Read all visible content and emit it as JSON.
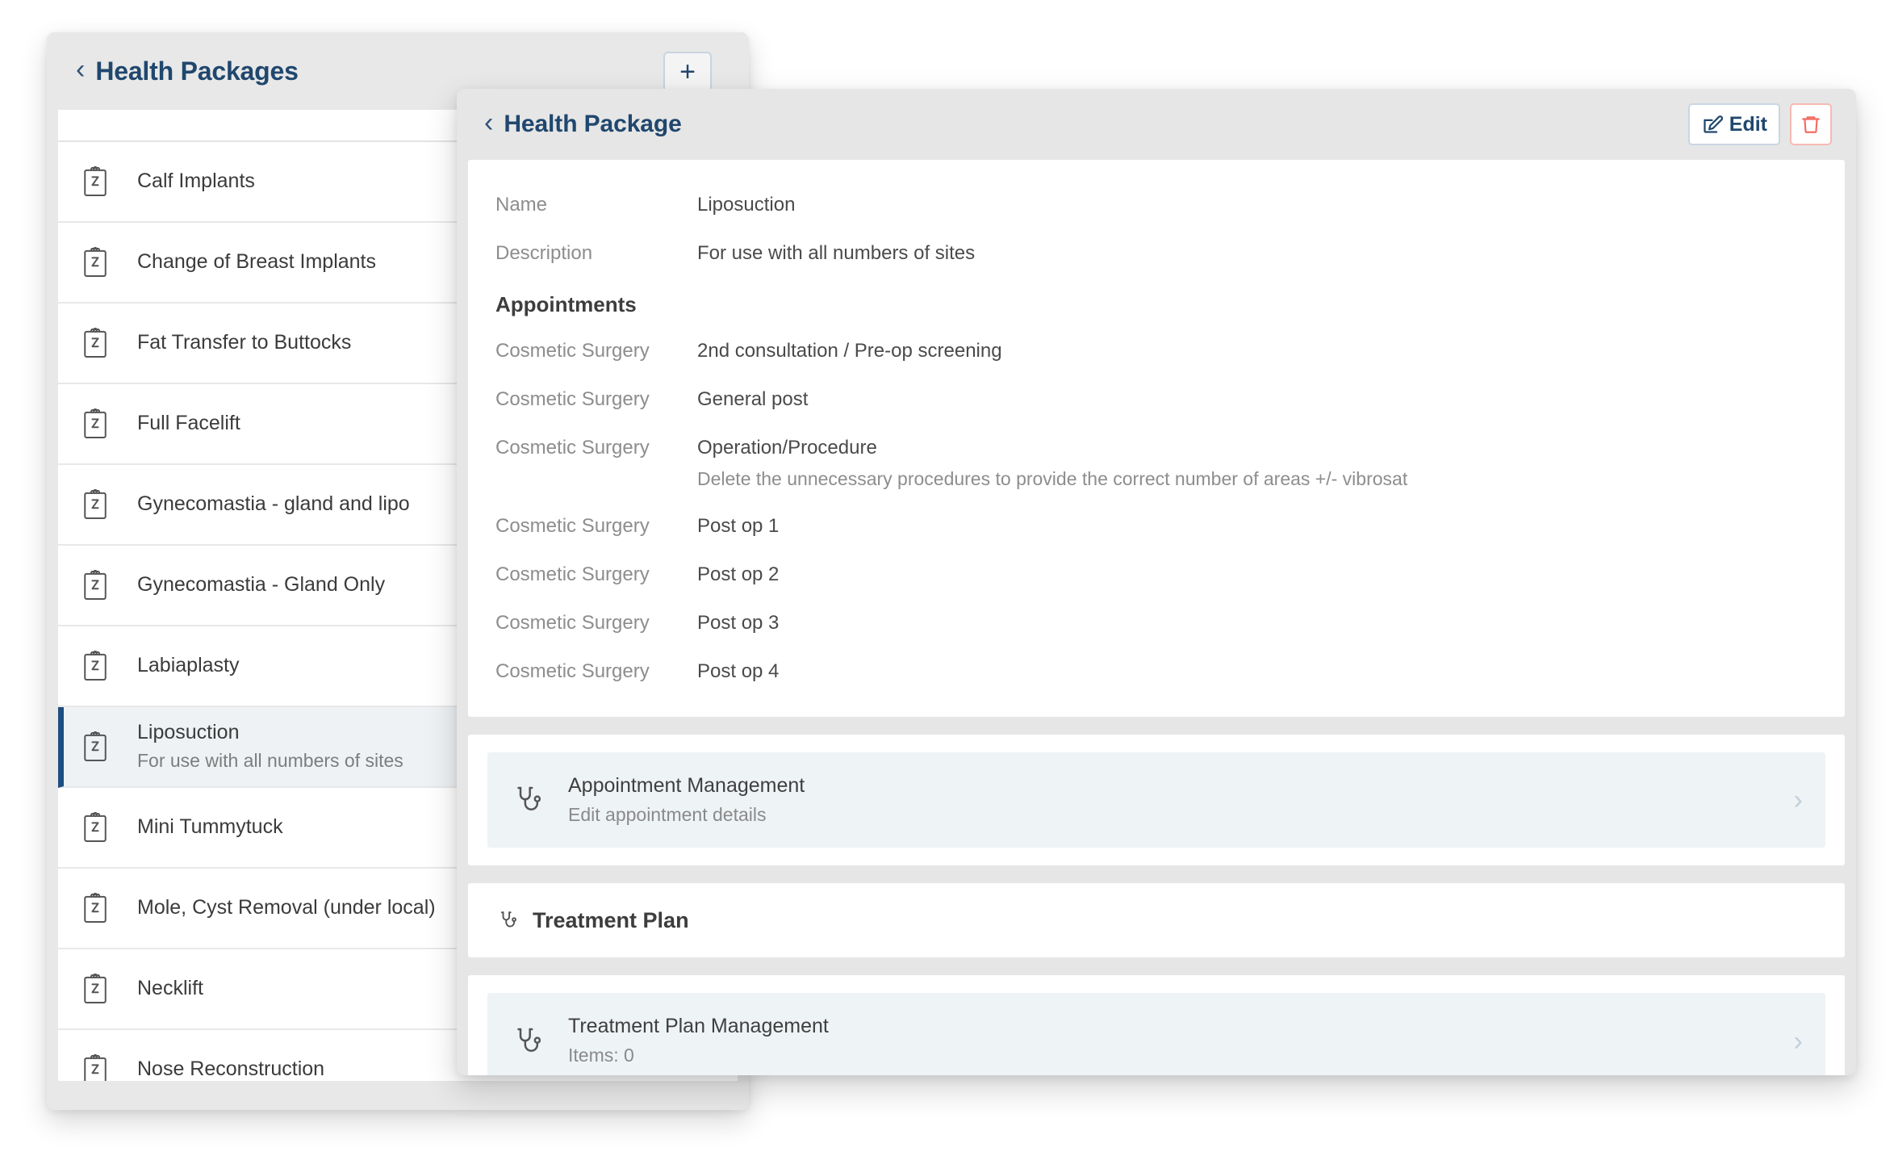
{
  "list_panel": {
    "back_icon": "chevron-left-icon",
    "title": "Health Packages",
    "add_button_label": "+",
    "item_icon": "clipboard-medical-icon",
    "items": [
      {
        "label": "Calf Implants",
        "sub": "",
        "selected": false
      },
      {
        "label": "Change of Breast Implants",
        "sub": "",
        "selected": false
      },
      {
        "label": "Fat Transfer to Buttocks",
        "sub": "",
        "selected": false
      },
      {
        "label": "Full Facelift",
        "sub": "",
        "selected": false
      },
      {
        "label": "Gynecomastia - gland and lipo",
        "sub": "",
        "selected": false
      },
      {
        "label": "Gynecomastia - Gland Only",
        "sub": "",
        "selected": false
      },
      {
        "label": "Labiaplasty",
        "sub": "",
        "selected": false
      },
      {
        "label": "Liposuction",
        "sub": "For use with all numbers of sites",
        "selected": true
      },
      {
        "label": "Mini Tummytuck",
        "sub": "",
        "selected": false
      },
      {
        "label": "Mole, Cyst Removal (under local)",
        "sub": "",
        "selected": false
      },
      {
        "label": "Necklift",
        "sub": "",
        "selected": false
      },
      {
        "label": "Nose Reconstruction",
        "sub": "",
        "selected": false
      }
    ]
  },
  "detail_panel": {
    "back_icon": "chevron-left-icon",
    "title": "Health Package",
    "edit_button": {
      "label": "Edit",
      "icon": "edit-pencil-icon",
      "color": "#20476e"
    },
    "delete_button": {
      "icon": "trash-icon",
      "color": "#f26c62"
    },
    "fields": [
      {
        "label": "Name",
        "value": "Liposuction",
        "sub": ""
      },
      {
        "label": "Description",
        "value": "For use with all numbers of sites",
        "sub": ""
      }
    ],
    "appointments_heading": "Appointments",
    "appointments": [
      {
        "label": "Cosmetic Surgery",
        "value": "2nd consultation / Pre-op screening",
        "sub": ""
      },
      {
        "label": "Cosmetic Surgery",
        "value": "General post",
        "sub": ""
      },
      {
        "label": "Cosmetic Surgery",
        "value": "Operation/Procedure",
        "sub": "Delete the unnecessary procedures to provide the correct number of areas +/- vibrosat"
      },
      {
        "label": "Cosmetic Surgery",
        "value": "Post op 1",
        "sub": ""
      },
      {
        "label": "Cosmetic Surgery",
        "value": "Post op 2",
        "sub": ""
      },
      {
        "label": "Cosmetic Surgery",
        "value": "Post op 3",
        "sub": ""
      },
      {
        "label": "Cosmetic Surgery",
        "value": "Post op 4",
        "sub": ""
      }
    ],
    "appointment_management": {
      "icon": "stethoscope-icon",
      "title": "Appointment Management",
      "sub": "Edit appointment details",
      "chevron": "chevron-right-icon"
    },
    "treatment_plan_heading": {
      "icon": "stethoscope-icon",
      "title": "Treatment Plan"
    },
    "treatment_plan_management": {
      "icon": "stethoscope-icon",
      "title": "Treatment Plan Management",
      "sub": "Items: 0",
      "chevron": "chevron-right-icon"
    }
  },
  "colors": {
    "accent_blue": "#20476e",
    "selected_border": "#1d4e80",
    "selected_bg": "#eef2f5",
    "action_row_bg": "#eef3f6",
    "danger": "#f26c62",
    "panel_bg": "#e8e8e8"
  }
}
